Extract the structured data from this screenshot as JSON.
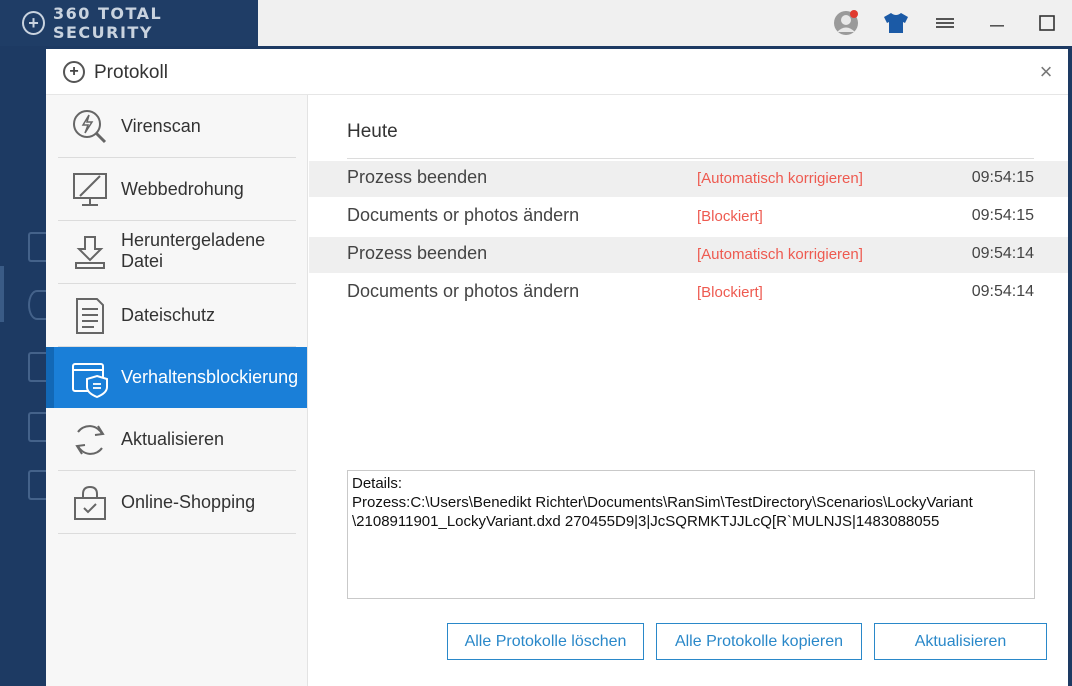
{
  "app": {
    "logo_text": "360 TOTAL SECURITY",
    "accent": "#1a7fd8",
    "titlebar_icons": [
      "user-avatar-icon",
      "shirt-icon",
      "menu-icon",
      "minimize-icon",
      "maximize-icon"
    ]
  },
  "dialog": {
    "title": "Protokoll",
    "close_label": "×"
  },
  "nav": {
    "items": [
      {
        "label": "Virenscan",
        "icon": "virus-scan-icon"
      },
      {
        "label": "Webbedrohung",
        "icon": "monitor-icon"
      },
      {
        "label": "Heruntergeladene Datei",
        "icon": "download-icon"
      },
      {
        "label": "Dateischutz",
        "icon": "document-icon"
      },
      {
        "label": "Verhaltensblockierung",
        "icon": "behavior-shield-icon",
        "active": true
      },
      {
        "label": "Aktualisieren",
        "icon": "refresh-icon"
      },
      {
        "label": "Online-Shopping",
        "icon": "shopping-bag-icon"
      }
    ]
  },
  "content": {
    "heading": "Heute",
    "rows": [
      {
        "event": "Prozess beenden",
        "status": "[Automatisch korrigieren]",
        "time": "09:54:15"
      },
      {
        "event": "Documents or photos ändern",
        "status": "[Blockiert]",
        "time": "09:54:15"
      },
      {
        "event": "Prozess beenden",
        "status": "[Automatisch korrigieren]",
        "time": "09:54:14"
      },
      {
        "event": "Documents or photos ändern",
        "status": "[Blockiert]",
        "time": "09:54:14"
      }
    ],
    "details": {
      "line1": "Details:",
      "line2": "Prozess:C:\\Users\\Benedikt Richter\\Documents\\RanSim\\TestDirectory\\Scenarios\\LockyVariant",
      "line3": "\\2108911901_LockyVariant.dxd 270455D9|3|JcSQRMKTJJLcQ[R`MULNJS|1483088055"
    },
    "status_color": "#ee5a50"
  },
  "buttons": {
    "clear_all": "Alle Protokolle löschen",
    "copy_all": "Alle Protokolle kopieren",
    "refresh": "Aktualisieren"
  }
}
